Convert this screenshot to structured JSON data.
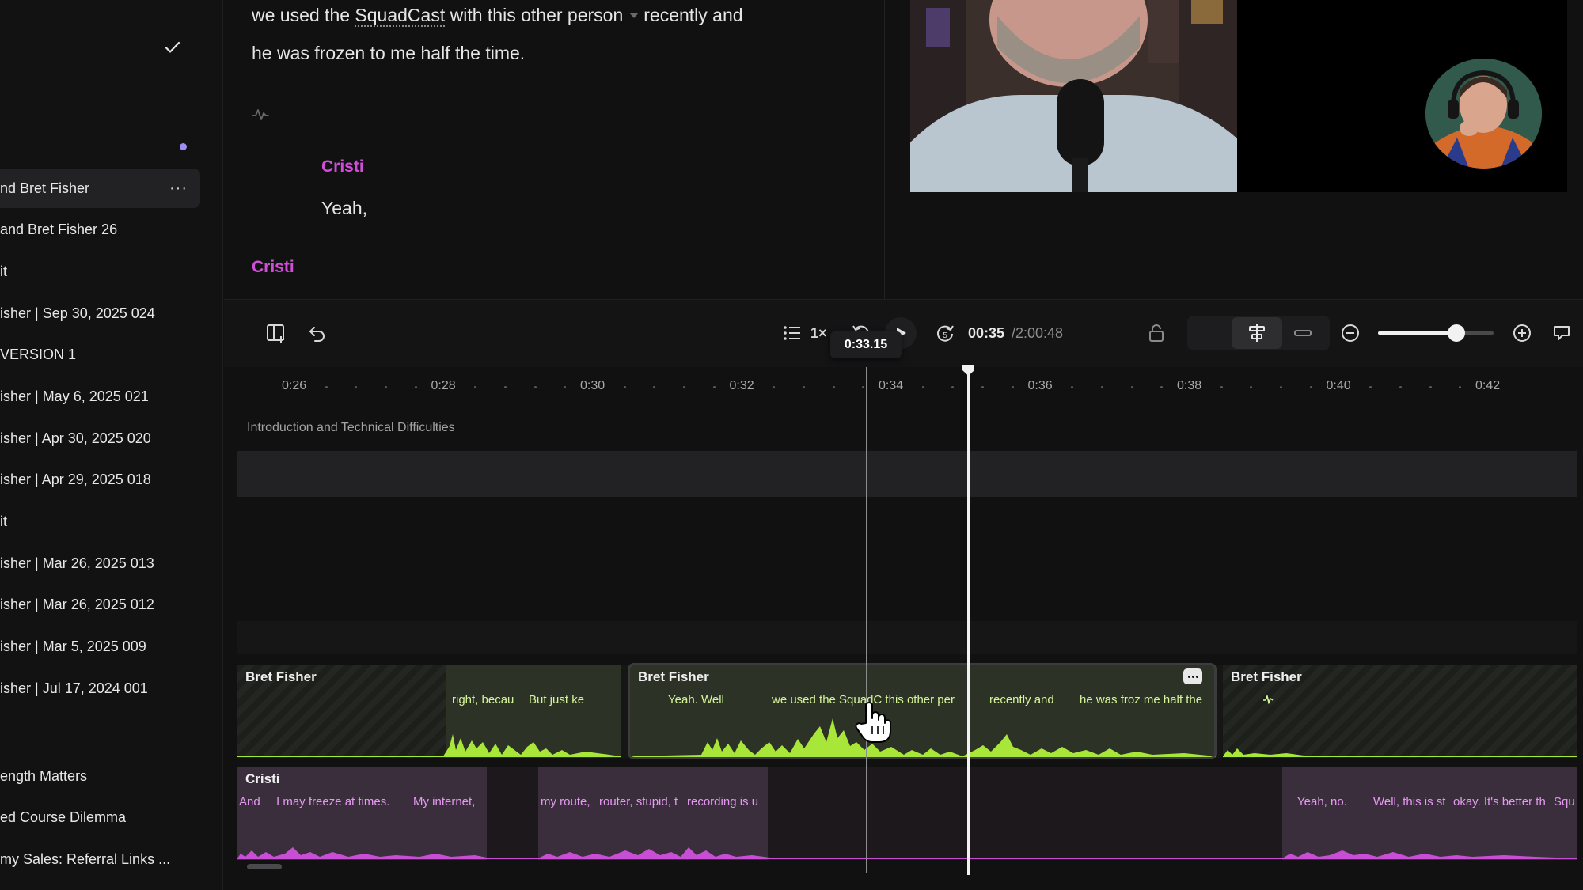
{
  "sidebar": {
    "items": [
      {
        "label": "nd Bret Fisher",
        "more": "···"
      },
      {
        "label": "and Bret Fisher 26"
      },
      {
        "label": "it"
      },
      {
        "label": "isher | Sep 30, 2025 024"
      },
      {
        "label": "VERSION 1"
      },
      {
        "label": "isher | May 6, 2025 021"
      },
      {
        "label": "isher | Apr 30, 2025 020"
      },
      {
        "label": "isher | Apr 29, 2025 018"
      },
      {
        "label": "it"
      },
      {
        "label": "isher | Mar 26, 2025 013"
      },
      {
        "label": "isher | Mar 26, 2025 012"
      },
      {
        "label": "isher | Mar 5, 2025 009"
      },
      {
        "label": "isher | Jul 17, 2024 001"
      },
      {
        "label": "ength Matters"
      },
      {
        "label": "ed Course Dilemma"
      },
      {
        "label": "my Sales: Referral Links ..."
      }
    ]
  },
  "transcript": {
    "line1_pre": "we used the ",
    "line1_link": "SquadCast",
    "line1_mid": " with this other person",
    "line1_post": "recently and",
    "line2": "he was frozen to me half the time.",
    "speaker1": "Cristi",
    "speaker1_text": "Yeah,",
    "speaker2": "Cristi"
  },
  "toolbar": {
    "speed": "1×",
    "current_time": "00:35",
    "total_time": "/2:00:48",
    "hover_tooltip": "0:33.15",
    "zoom_level": 0.68
  },
  "timeline": {
    "ticks": [
      "0:26",
      "0:28",
      "0:30",
      "0:32",
      "0:34",
      "0:36",
      "0:38",
      "0:40",
      "0:42"
    ],
    "chapter": "Introduction and Technical Difficulties",
    "tracks": {
      "bret": {
        "clips": [
          {
            "name": "Bret Fisher",
            "segments": [
              "right, becau",
              "But just ke"
            ]
          },
          {
            "name": "Bret Fisher",
            "segments": [
              "Yeah. Well",
              "we used the SquadC this other per",
              "recently and",
              "he was froz me half the"
            ]
          },
          {
            "name": "Bret Fisher",
            "segments": []
          }
        ]
      },
      "cristi": {
        "name": "Cristi",
        "segments": [
          "And",
          "I may freeze at times.",
          "My internet,",
          "my route,",
          "router, stupid, t",
          "recording is u",
          "Yeah, no.",
          "Well, this is st",
          "okay. It's better th",
          "Squ"
        ]
      }
    }
  },
  "colors": {
    "bret_wave": "#a8e63a",
    "cristi_wave": "#c84ed6",
    "speaker": "#d14fd8",
    "accent_dot": "#9f8df5"
  }
}
